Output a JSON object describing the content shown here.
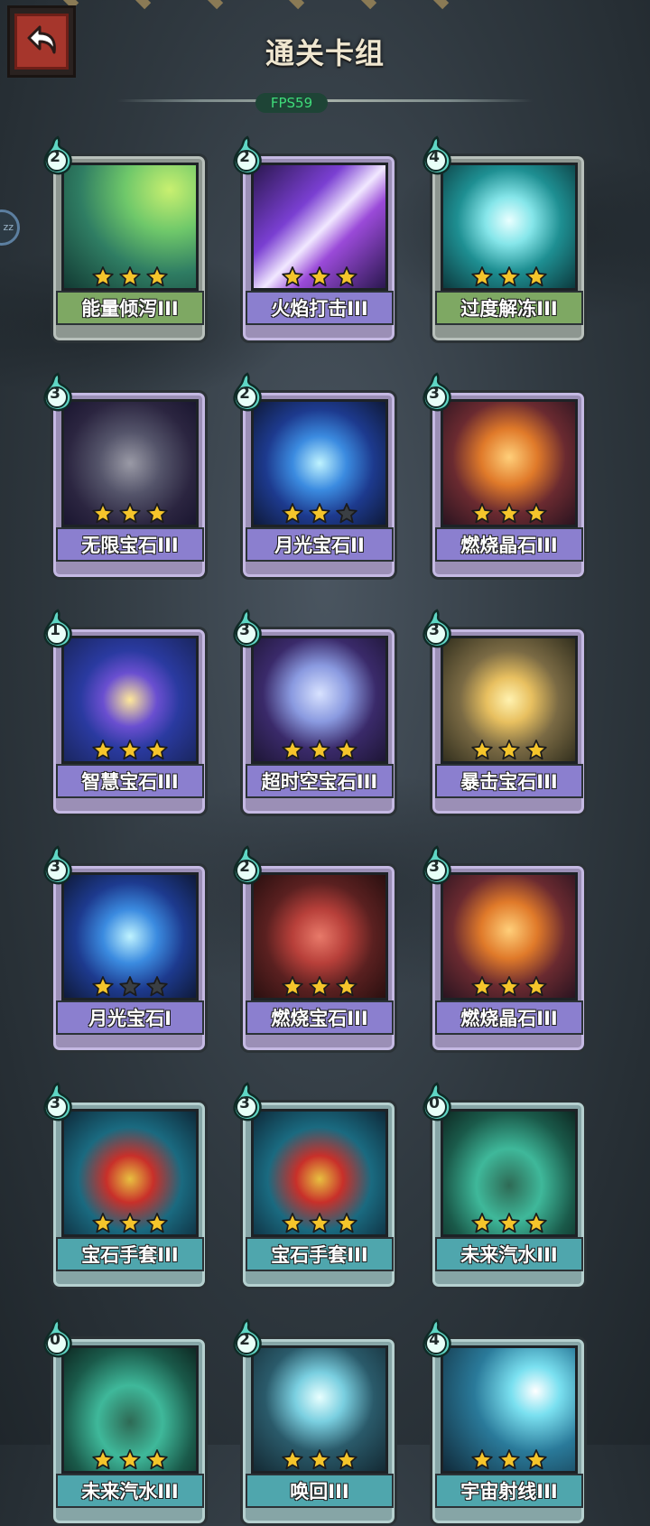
{
  "header": {
    "title": "通关卡组",
    "fps": "FPS59",
    "side_tab": "zz"
  },
  "icons": {
    "back": "back-arrow-icon",
    "cost": "energy-flame-icon",
    "star": "star-icon"
  },
  "colors": {
    "star_on": "#f5c52b",
    "star_off": "#3a3f44",
    "cost_flame": "#5fd6c4"
  },
  "cards": [
    {
      "name": "能量倾泻III",
      "cost": "2",
      "stars": 3,
      "rarity": "green",
      "art": "green-energy-wave"
    },
    {
      "name": "火焰打击III",
      "cost": "2",
      "stars": 3,
      "rarity": "purple",
      "art": "purple-fire-strike"
    },
    {
      "name": "过度解冻III",
      "cost": "4",
      "stars": 3,
      "rarity": "green",
      "art": "ice-cube"
    },
    {
      "name": "无限宝石III",
      "cost": "3",
      "stars": 3,
      "rarity": "purple",
      "art": "infinity-gem"
    },
    {
      "name": "月光宝石II",
      "cost": "2",
      "stars": 2,
      "rarity": "purple",
      "art": "moonlight-gem"
    },
    {
      "name": "燃烧晶石III",
      "cost": "3",
      "stars": 3,
      "rarity": "purple",
      "art": "burning-crystal"
    },
    {
      "name": "智慧宝石III",
      "cost": "1",
      "stars": 3,
      "rarity": "purple",
      "art": "wisdom-gem"
    },
    {
      "name": "超时空宝石III",
      "cost": "3",
      "stars": 3,
      "rarity": "purple",
      "art": "spacetime-gem"
    },
    {
      "name": "暴击宝石III",
      "cost": "3",
      "stars": 3,
      "rarity": "purple",
      "art": "crit-gem"
    },
    {
      "name": "月光宝石I",
      "cost": "3",
      "stars": 1,
      "rarity": "purple",
      "art": "moonlight-gem"
    },
    {
      "name": "燃烧宝石III",
      "cost": "2",
      "stars": 3,
      "rarity": "purple",
      "art": "burning-gem"
    },
    {
      "name": "燃烧晶石III",
      "cost": "3",
      "stars": 3,
      "rarity": "purple",
      "art": "burning-crystal"
    },
    {
      "name": "宝石手套III",
      "cost": "3",
      "stars": 3,
      "rarity": "teal",
      "art": "gem-gauntlet"
    },
    {
      "name": "宝石手套III",
      "cost": "3",
      "stars": 3,
      "rarity": "teal",
      "art": "gem-gauntlet"
    },
    {
      "name": "未来汽水III",
      "cost": "0",
      "stars": 3,
      "rarity": "teal",
      "art": "future-soda"
    },
    {
      "name": "未来汽水III",
      "cost": "0",
      "stars": 3,
      "rarity": "teal",
      "art": "future-soda"
    },
    {
      "name": "唤回III",
      "cost": "2",
      "stars": 3,
      "rarity": "teal",
      "art": "recall-swirl"
    },
    {
      "name": "宇宙射线III",
      "cost": "4",
      "stars": 3,
      "rarity": "teal",
      "art": "cosmic-ray"
    }
  ]
}
